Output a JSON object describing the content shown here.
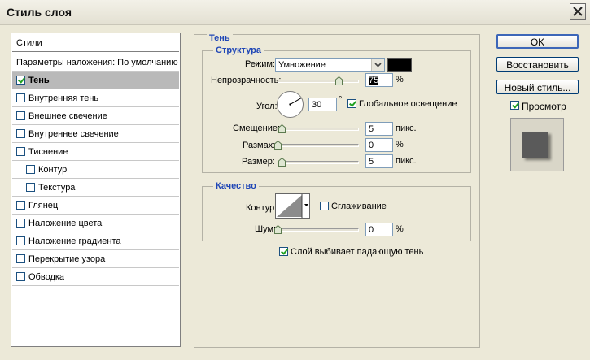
{
  "window": {
    "title": "Стиль слоя"
  },
  "sidebar": {
    "header": "Стили",
    "items": [
      {
        "label": "Параметры наложения: По умолчанию",
        "checkbox": false,
        "checked": false,
        "indent": 0,
        "bold": false
      },
      {
        "label": "Тень",
        "checkbox": true,
        "checked": true,
        "indent": 0,
        "bold": true,
        "selected": true
      },
      {
        "label": "Внутренняя тень",
        "checkbox": true,
        "checked": false,
        "indent": 0
      },
      {
        "label": "Внешнее свечение",
        "checkbox": true,
        "checked": false,
        "indent": 0
      },
      {
        "label": "Внутреннее свечение",
        "checkbox": true,
        "checked": false,
        "indent": 0
      },
      {
        "label": "Тиснение",
        "checkbox": true,
        "checked": false,
        "indent": 0
      },
      {
        "label": "Контур",
        "checkbox": true,
        "checked": false,
        "indent": 1
      },
      {
        "label": "Текстура",
        "checkbox": true,
        "checked": false,
        "indent": 1
      },
      {
        "label": "Глянец",
        "checkbox": true,
        "checked": false,
        "indent": 0
      },
      {
        "label": "Наложение цвета",
        "checkbox": true,
        "checked": false,
        "indent": 0
      },
      {
        "label": "Наложение градиента",
        "checkbox": true,
        "checked": false,
        "indent": 0
      },
      {
        "label": "Перекрытие узора",
        "checkbox": true,
        "checked": false,
        "indent": 0
      },
      {
        "label": "Обводка",
        "checkbox": true,
        "checked": false,
        "indent": 0
      }
    ]
  },
  "panel": {
    "title": "Тень",
    "structure": {
      "title": "Структура",
      "mode_label": "Режим:",
      "mode_value": "Умножение",
      "color": "#000000",
      "opacity_label": "Непрозрачность:",
      "opacity_value": "75",
      "opacity_unit": "%",
      "opacity_fraction": 0.75,
      "angle_label": "Угол:",
      "angle_value": "30",
      "angle_unit": "°",
      "global_light_label": "Глобальное освещение",
      "global_light_checked": true,
      "distance_label": "Смещение:",
      "distance_value": "5",
      "distance_unit": "пикс.",
      "spread_label": "Размах:",
      "spread_value": "0",
      "spread_unit": "%",
      "size_label": "Размер:",
      "size_value": "5",
      "size_unit": "пикс."
    },
    "quality": {
      "title": "Качество",
      "contour_label": "Контур:",
      "antialias_label": "Сглаживание",
      "antialias_checked": false,
      "noise_label": "Шум:",
      "noise_value": "0",
      "noise_unit": "%"
    },
    "knockout_label": "Слой выбивает падающую тень",
    "knockout_checked": true
  },
  "buttons": {
    "ok": "OK",
    "reset": "Восстановить",
    "new_style": "Новый стиль...",
    "preview_label": "Просмотр",
    "preview_checked": true
  }
}
